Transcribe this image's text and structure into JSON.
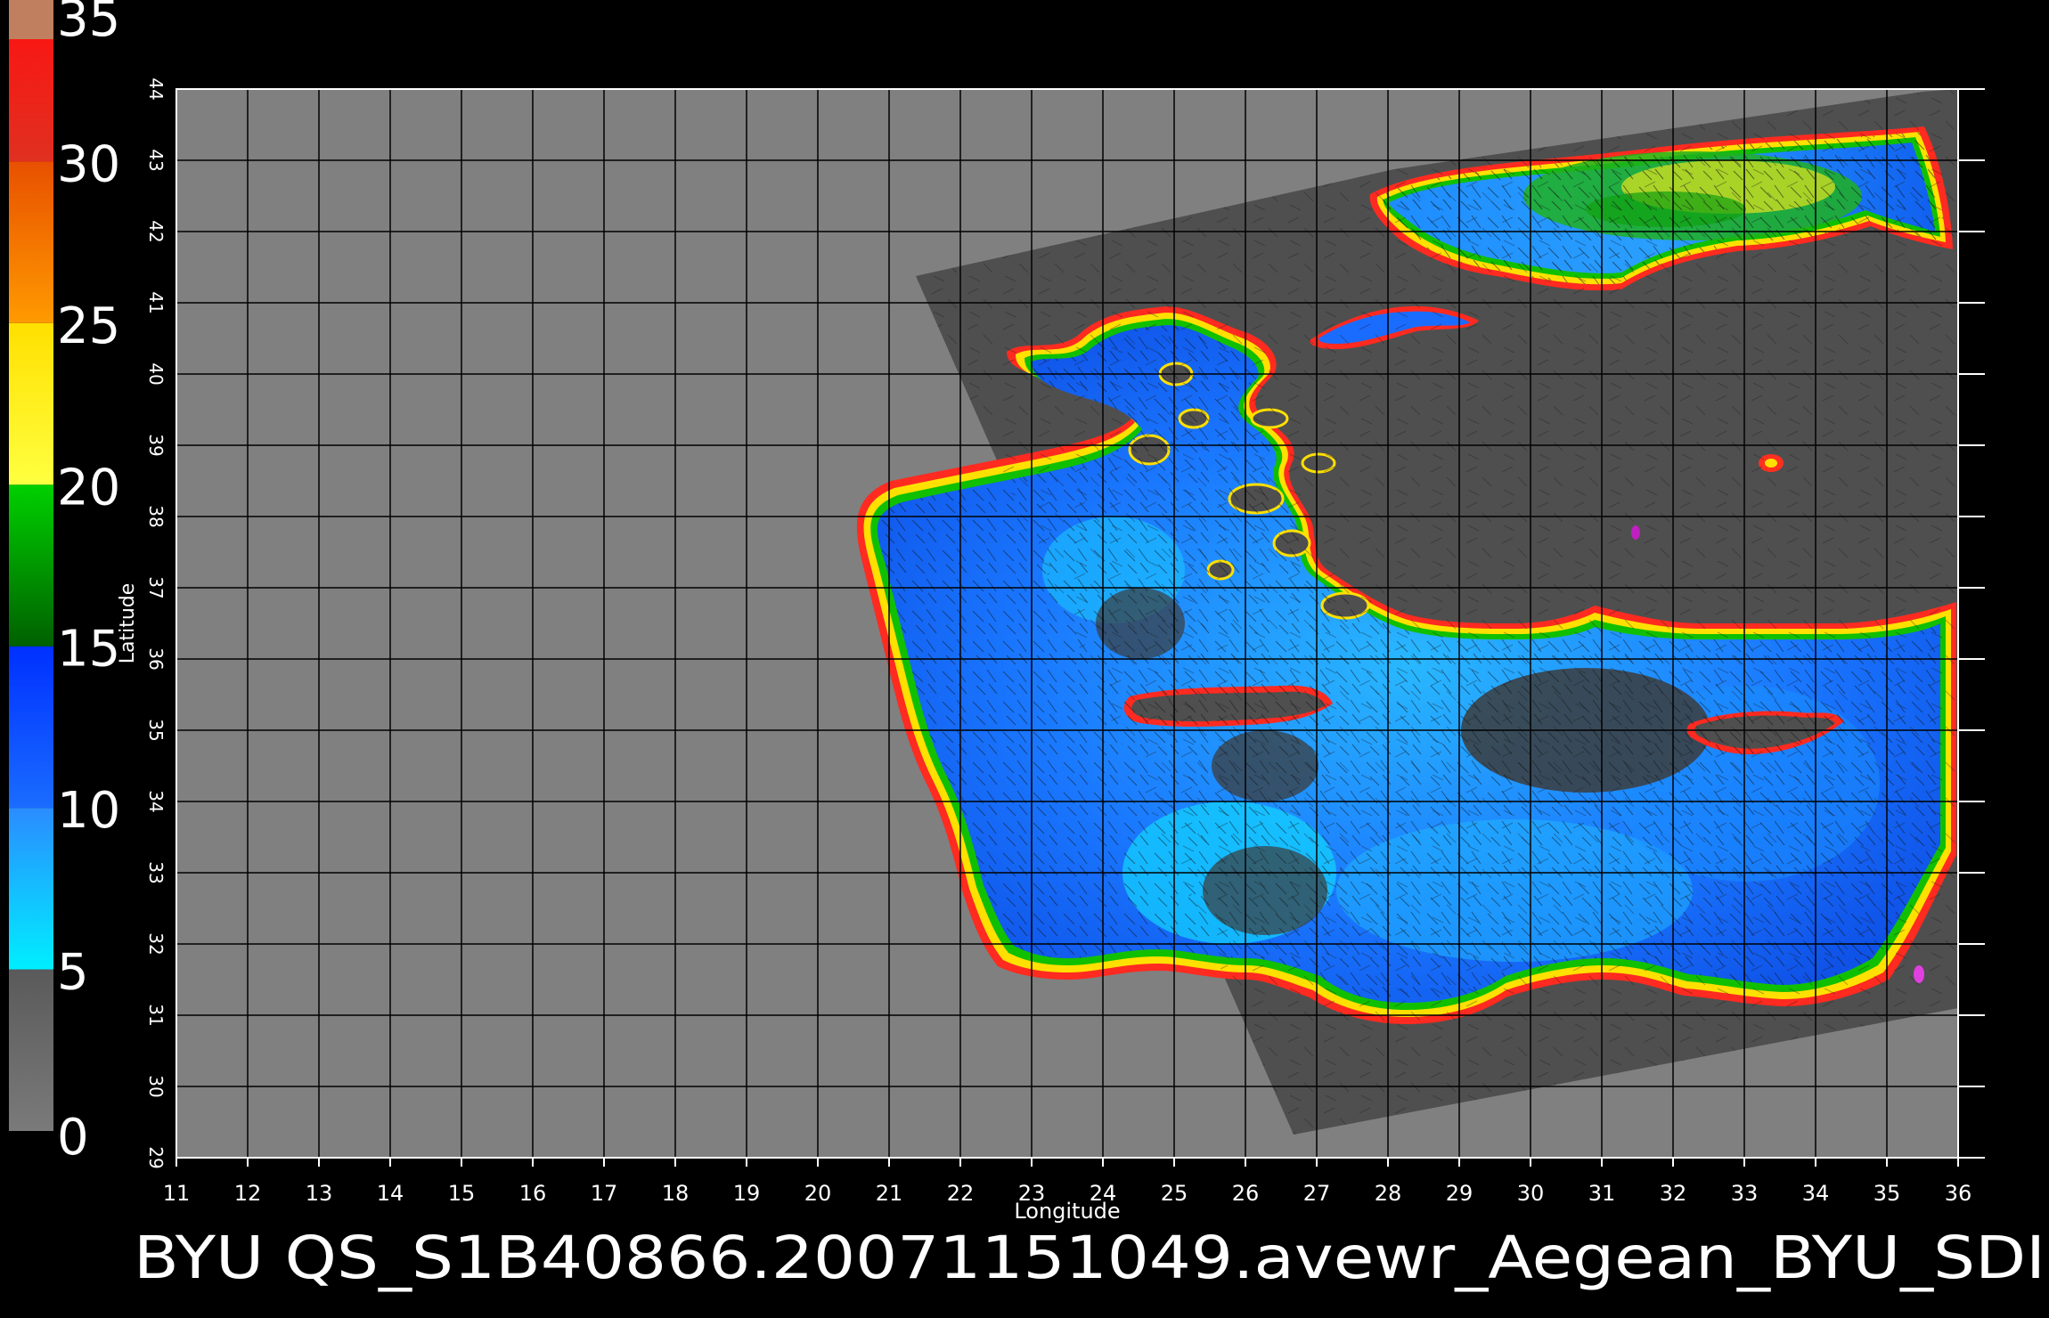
{
  "window": {
    "caption": "BYU  QS_S1B40866.20071151049.avewr_Aegean_BYU_SDI"
  },
  "colorbar": {
    "labels": [
      "0",
      "5",
      "10",
      "15",
      "20",
      "25",
      "30",
      "35"
    ],
    "values": [
      0,
      5,
      10,
      15,
      20,
      25,
      30,
      35
    ],
    "segments": [
      {
        "from": 0,
        "to": 5,
        "color_top": "#5a5a5a",
        "color_bottom": "#7a7a7a"
      },
      {
        "from": 5,
        "to": 10,
        "color_top": "#2a8cff",
        "color_bottom": "#00eeff"
      },
      {
        "from": 10,
        "to": 15,
        "color_top": "#0030ff",
        "color_bottom": "#1a6cff"
      },
      {
        "from": 15,
        "to": 20,
        "color_top": "#00d000",
        "color_bottom": "#006000"
      },
      {
        "from": 20,
        "to": 25,
        "color_top": "#ffe000",
        "color_bottom": "#ffff40"
      },
      {
        "from": 25,
        "to": 30,
        "color_top": "#e85000",
        "color_bottom": "#ff9a00"
      },
      {
        "from": 30,
        "to": 35,
        "color_top": "#ff1010",
        "color_bottom": "#e03020"
      }
    ],
    "cap_color": "#c08060"
  },
  "map": {
    "xlabel": "Longitude",
    "ylabel": "Latitude",
    "lon_range": [
      11,
      36
    ],
    "lat_range": [
      29,
      44
    ],
    "lon_ticks": [
      "11",
      "12",
      "13",
      "14",
      "15",
      "16",
      "17",
      "18",
      "19",
      "20",
      "21",
      "22",
      "23",
      "24",
      "25",
      "26",
      "27",
      "28",
      "29",
      "30",
      "31",
      "32",
      "33",
      "34",
      "35",
      "36"
    ],
    "lat_ticks": [
      "29",
      "30",
      "31",
      "32",
      "33",
      "34",
      "35",
      "36",
      "37",
      "38",
      "39",
      "40",
      "41",
      "42",
      "43",
      "44"
    ],
    "colors": {
      "background": "#000000",
      "no_data": "#808080",
      "land": "#4f4f4f",
      "grid": "#000000",
      "text": "#ffffff",
      "sea_low": "#00d8ff",
      "sea_mid": "#1a78ff",
      "sea_high": "#0038f0",
      "wind_vector": "#111111"
    }
  }
}
